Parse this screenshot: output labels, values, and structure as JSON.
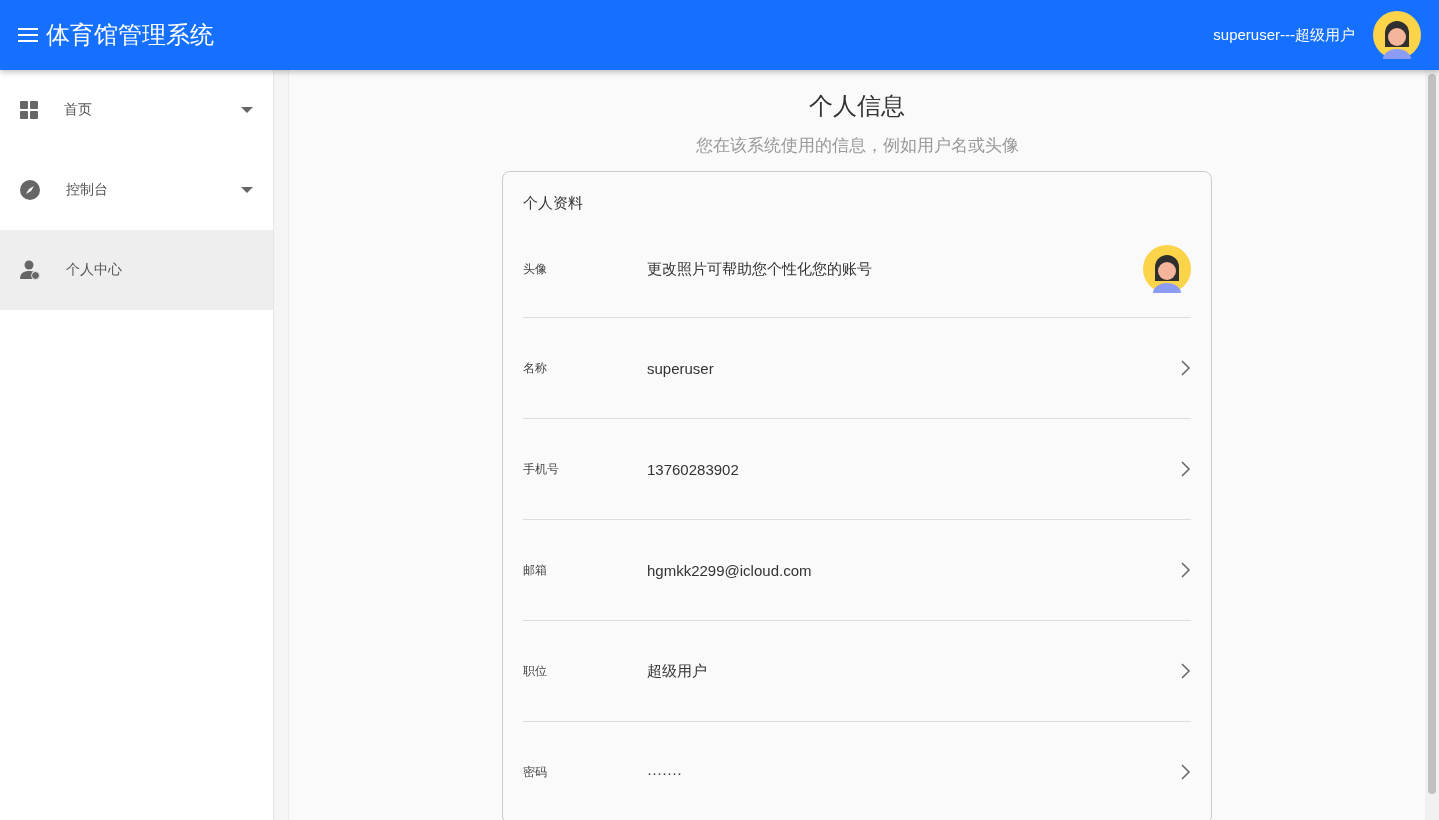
{
  "header": {
    "title": "体育馆管理系统",
    "user": "superuser---超级用户"
  },
  "sidebar": {
    "items": [
      {
        "label": "首页",
        "kind": "grid",
        "expandable": true,
        "selected": false
      },
      {
        "label": "控制台",
        "kind": "compass",
        "expandable": true,
        "selected": false
      },
      {
        "label": "个人中心",
        "kind": "person",
        "expandable": false,
        "selected": true
      }
    ]
  },
  "page": {
    "title": "个人信息",
    "subtitle": "您在该系统使用的信息，例如用户名或头像"
  },
  "card": {
    "title": "个人资料",
    "rows": [
      {
        "kind": "avatar",
        "label": "头像",
        "value": "更改照片可帮助您个性化您的账号"
      },
      {
        "kind": "link",
        "label": "名称",
        "value": "superuser"
      },
      {
        "kind": "link",
        "label": "手机号",
        "value": "13760283902"
      },
      {
        "kind": "link",
        "label": "邮箱",
        "value": "hgmkk2299@icloud.com"
      },
      {
        "kind": "link",
        "label": "职位",
        "value": "超级用户"
      },
      {
        "kind": "link",
        "label": "密码",
        "value": "·······"
      }
    ]
  }
}
